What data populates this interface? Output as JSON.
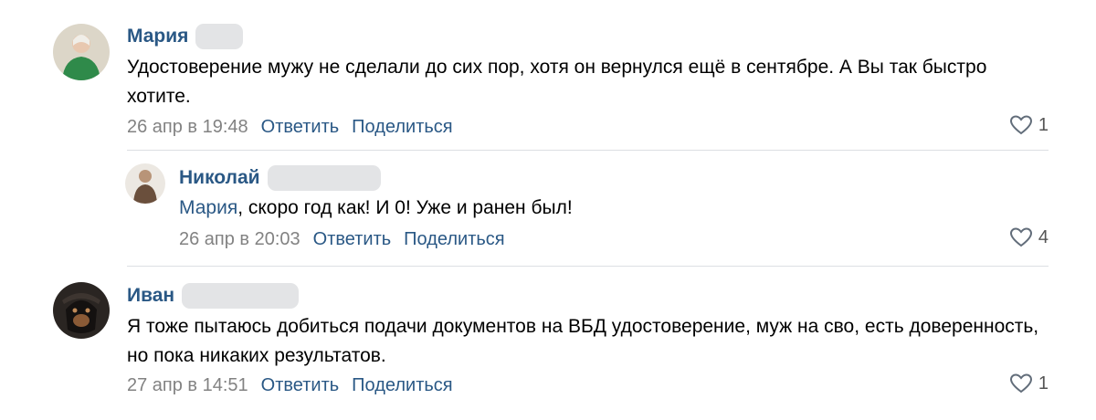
{
  "comments": [
    {
      "author": "Мария",
      "text": "Удостоверение мужу не сделали до сих пор, хотя он вернулся ещё в сентябре. А Вы так быстро хотите.",
      "date": "26 апр в 19:48",
      "reply_label": "Ответить",
      "share_label": "Поделиться",
      "likes": "1",
      "avatar_icon": "user-avatar-photo"
    },
    {
      "author": "Николай",
      "mention": "Мария",
      "text": ", скоро год как! И 0! Уже и ранен был!",
      "date": "26 апр в 20:03",
      "reply_label": "Ответить",
      "share_label": "Поделиться",
      "likes": "4",
      "avatar_icon": "user-avatar-photo"
    },
    {
      "author": "Иван",
      "text": "Я тоже пытаюсь добиться подачи документов на ВБД удостоверение, муж на сво, есть доверенность, но пока никаких результатов.",
      "date": "27 апр в 14:51",
      "reply_label": "Ответить",
      "share_label": "Поделиться",
      "likes": "1",
      "avatar_icon": "dog-avatar-photo"
    }
  ],
  "colors": {
    "link": "#2a5885",
    "meta": "#828282",
    "divider": "#dcdfe3",
    "redaction": "#e3e4e6"
  },
  "icons": {
    "like": "heart-outline-icon"
  }
}
